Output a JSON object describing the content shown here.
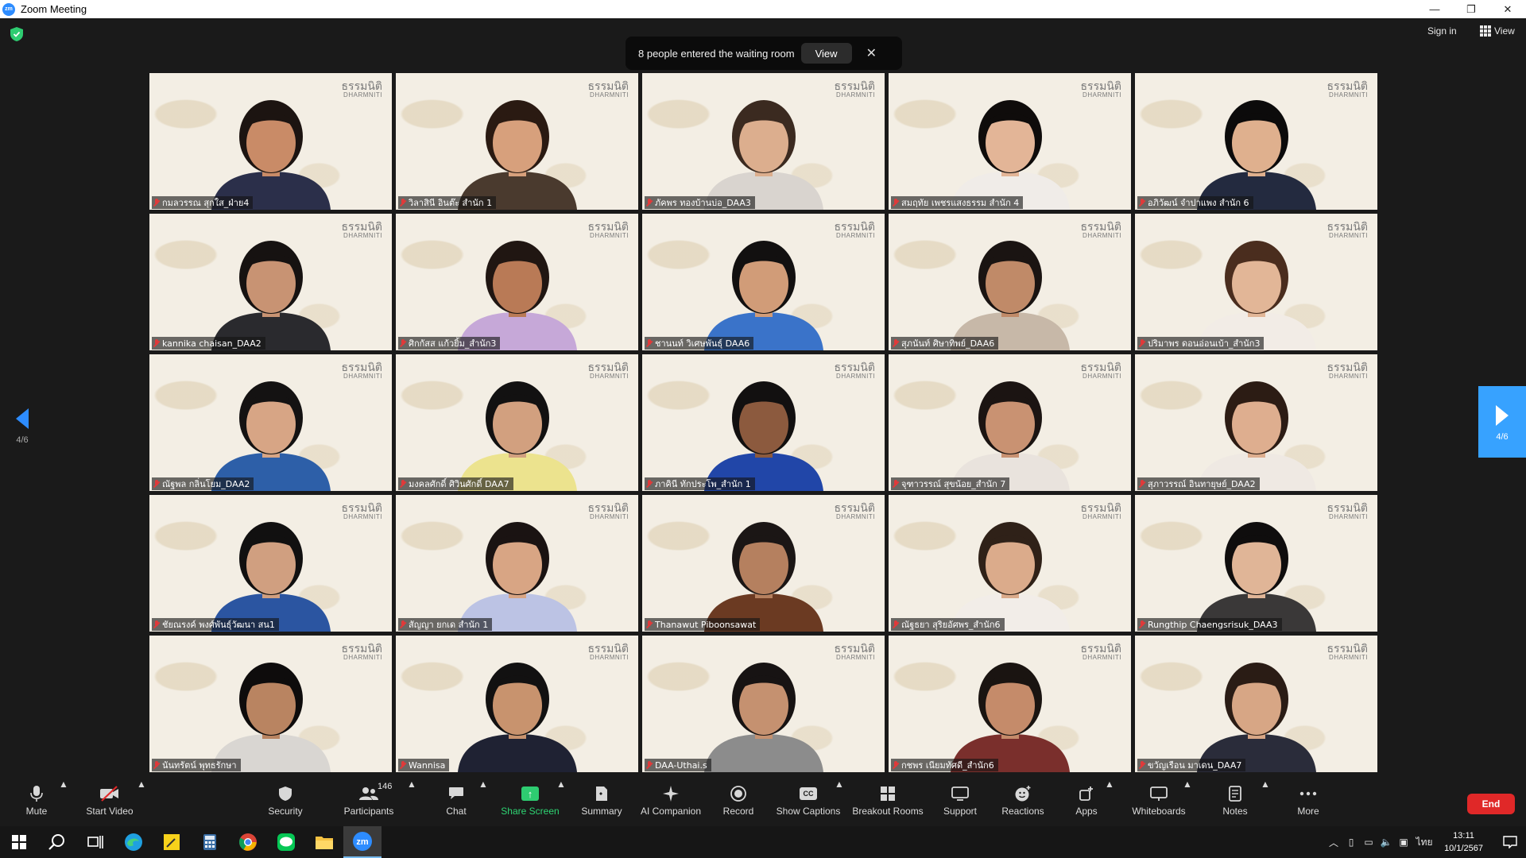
{
  "window": {
    "title": "Zoom Meeting",
    "app_logo_text": "zm",
    "controls": [
      "—",
      "❐",
      "✕"
    ]
  },
  "header": {
    "sign_in": "Sign in",
    "view": "View"
  },
  "notification": {
    "message": "8 people entered the waiting room",
    "view_button": "View",
    "close": "✕"
  },
  "watermark": {
    "thai": "ธรรมนิติ",
    "english": "DHARMNITI"
  },
  "pagination": {
    "left_page": "4/6",
    "right_page": "4/6"
  },
  "participants": [
    {
      "name": "กมลวรรณ สุกใส_ฝ่าย4",
      "skin": "#c98b67",
      "hair": "#1c1411",
      "shirt": "#2b2f4a"
    },
    {
      "name": "วิลาสินี อินต๊ะ สำนัก 1",
      "skin": "#d7a07c",
      "hair": "#2a1a12",
      "shirt": "#4a3a2e"
    },
    {
      "name": "ภัคพร ทองบ้านบ่อ_DAA3",
      "skin": "#dcae8e",
      "hair": "#3b2a20",
      "shirt": "#d9d4cf"
    },
    {
      "name": "สมฤทัย เพชรแสงธรรม สำนัก 4",
      "skin": "#e3b597",
      "hair": "#0f0c0b",
      "shirt": "#f0ece8"
    },
    {
      "name": "อภิวัฒน์ จำปาแพง สำนัก 6",
      "skin": "#dfb08e",
      "hair": "#0c0b0b",
      "shirt": "#232a3f"
    },
    {
      "name": "kannika chaisan_DAA2",
      "skin": "#c89373",
      "hair": "#161211",
      "shirt": "#2a2a2e"
    },
    {
      "name": "ศิกกัสส แก้วยิ้ม_สำนัก3",
      "skin": "#b97a56",
      "hair": "#201612",
      "shirt": "#c6a8d8"
    },
    {
      "name": "ชานนท์ วิเศษพันธุ์ DAA6",
      "skin": "#d19c78",
      "hair": "#121010",
      "shirt": "#3a73c9"
    },
    {
      "name": "สุภนันท์ ศิษาทิพย์_DAA6",
      "skin": "#c08a68",
      "hair": "#1a1412",
      "shirt": "#c7b8a8"
    },
    {
      "name": "ปริมาพร ดอนอ่อนเบ้า_สำนัก3",
      "skin": "#e2b697",
      "hair": "#4a2d1e",
      "shirt": "#f2ece6"
    },
    {
      "name": "ณัฐพล กลิ่นโยม_DAA2",
      "skin": "#d7a585",
      "hair": "#141212",
      "shirt": "#2d5fa8"
    },
    {
      "name": "มงคลศักดิ์ ศิวินศักดิ์ DAA7",
      "skin": "#d2a07f",
      "hair": "#121111",
      "shirt": "#ece38e"
    },
    {
      "name": "ภาคินี ทักประโพ_สำนัก 1",
      "skin": "#8c5a3e",
      "hair": "#121010",
      "shirt": "#2146a8"
    },
    {
      "name": "จุฑาวรรณ์ สุขน้อย_สำนัก 7",
      "skin": "#c99272",
      "hair": "#1b1412",
      "shirt": "#e9e3dd"
    },
    {
      "name": "สุภาวรรณ์ อินทายุษย์_DAA2",
      "skin": "#deae8f",
      "hair": "#2c1c14",
      "shirt": "#efe9e3"
    },
    {
      "name": "ชัยณรงค์ พงศ์พันธุ์วัฒนา สน1",
      "skin": "#d09f80",
      "hair": "#111010",
      "shirt": "#2b55a1"
    },
    {
      "name": "สัญญา ยกเด สำนัก 1",
      "skin": "#d8a584",
      "hair": "#1a1312",
      "shirt": "#bcc3e4"
    },
    {
      "name": "Thanawut Piboonsawat",
      "skin": "#b5805f",
      "hair": "#1b1615",
      "shirt": "#6b3a22"
    },
    {
      "name": "ณัฐธยา สุริยอัศพร_สำนัก6",
      "skin": "#dbab8b",
      "hair": "#2f2118",
      "shirt": "#f2ede8"
    },
    {
      "name": "Rungthip Chaengsrisuk_DAA3",
      "skin": "#e0b597",
      "hair": "#0f0d0d",
      "shirt": "#3a3838"
    },
    {
      "name": "นันทรัตน์ พุทธรักษา",
      "skin": "#b98461",
      "hair": "#0e0c0c",
      "shirt": "#d9d6d2"
    },
    {
      "name": "Wannisa",
      "skin": "#c8936e",
      "hair": "#121111",
      "shirt": "#1f2233"
    },
    {
      "name": "DAA-Uthai.s",
      "skin": "#c59170",
      "hair": "#171313",
      "shirt": "#8c8c8c"
    },
    {
      "name": "กชพร เนียมทัศดี_สำนัก6",
      "skin": "#c58b6a",
      "hair": "#1a1411",
      "shirt": "#7a2f2c"
    },
    {
      "name": "ขวัญเรือน มาเดน_DAA7",
      "skin": "#d7a685",
      "hair": "#2a1c15",
      "shirt": "#2a2c3a"
    }
  ],
  "toolbar": {
    "mute": "Mute",
    "start_video": "Start Video",
    "security": "Security",
    "participants": "Participants",
    "participant_count": "146",
    "chat": "Chat",
    "share_screen": "Share Screen",
    "summary": "Summary",
    "ai_companion": "AI Companion",
    "record": "Record",
    "captions": "Show Captions",
    "breakout": "Breakout Rooms",
    "support": "Support",
    "reactions": "Reactions",
    "apps": "Apps",
    "whiteboards": "Whiteboards",
    "notes": "Notes",
    "more": "More",
    "end": "End"
  },
  "taskbar": {
    "time": "13:11",
    "date": "10/1/2567",
    "lang": "ไทย"
  },
  "colors": {
    "accent": "#2d8cff",
    "end": "#e02828",
    "share": "#2ecc71"
  }
}
